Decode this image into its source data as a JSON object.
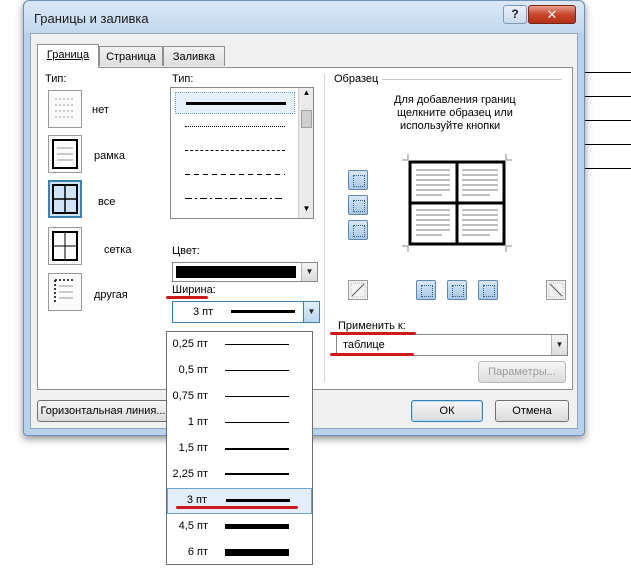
{
  "dialog": {
    "title": "Границы и заливка",
    "help_label": "?",
    "close_label": "✕"
  },
  "tabs": [
    {
      "label": "Граница",
      "active": true
    },
    {
      "label": "Страница",
      "active": false
    },
    {
      "label": "Заливка",
      "active": false
    }
  ],
  "setting": {
    "label": "Тип:",
    "options": [
      {
        "label": "нет",
        "icon": "no-border-icon"
      },
      {
        "label": "рамка",
        "icon": "box-border-icon"
      },
      {
        "label": "все",
        "icon": "all-borders-icon",
        "selected": true
      },
      {
        "label": "сетка",
        "icon": "grid-border-icon"
      },
      {
        "label": "другая",
        "icon": "custom-border-icon"
      }
    ]
  },
  "style": {
    "label": "Тип:",
    "items": [
      "solid",
      "dotted",
      "dashed-small",
      "dashed",
      "dash-dot"
    ]
  },
  "color": {
    "label": "Цвет:",
    "value_color": "#000000"
  },
  "width": {
    "label": "Ширина:",
    "value": "3 пт",
    "options": [
      "0,25 пт",
      "0,5 пт",
      "0,75 пт",
      "1 пт",
      "1,5 пт",
      "2,25 пт",
      "3 пт",
      "4,5 пт",
      "6 пт"
    ],
    "selected": "3 пт"
  },
  "preview": {
    "label": "Образец",
    "instructions_line1": "Для добавления границ",
    "instructions_line2": "щелкните образец или",
    "instructions_line3": "используйте кнопки"
  },
  "apply_to": {
    "label": "Применить к:",
    "value": "таблице"
  },
  "buttons": {
    "options": "Параметры...",
    "horizontal_line": "Горизонтальная линия...",
    "ok": "ОК",
    "cancel": "Отмена"
  },
  "colors": {
    "accent": "#3c7fb1",
    "annotation_red": "#cc1a1a",
    "title_bar": "#c2d7ee"
  }
}
